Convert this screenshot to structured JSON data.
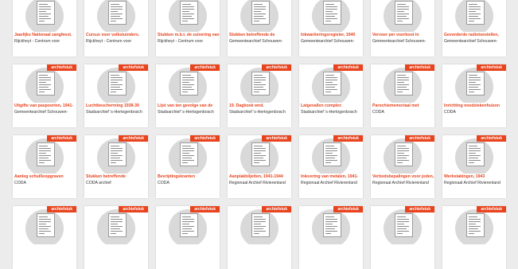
{
  "badge_label": "archiefstuk",
  "colors": {
    "accent": "#e8431d",
    "card": "#ffffff",
    "background": "#ececec",
    "thumb_circle": "#d9d9d9"
  },
  "rows": [
    {
      "show_badge": false,
      "items": [
        {
          "title": "Jaarlijks Nationaal zangfeest.",
          "source": "Rijckheyt - Centrum voor"
        },
        {
          "title": "Cursus voor volkstuinders.",
          "source": "Rijckheyt - Centrum voor"
        },
        {
          "title": "Stukken m.b.t. de zuivering van",
          "source": "Rijckheyt - Centrum voor"
        },
        {
          "title": "Stukken betreffende de",
          "source": "Gemeentearchief Schouwen-"
        },
        {
          "title": "Inkwartieringsregister, 1940",
          "source": "Gemeentearchief Schouwen-"
        },
        {
          "title": "Vervoer per voorboot in",
          "source": "Gemeentearchief Schouwen-"
        },
        {
          "title": "Gevorderde radiotoestellen,",
          "source": "Gemeentearchief Schouwen-"
        }
      ]
    },
    {
      "show_badge": true,
      "items": [
        {
          "title": "Uitgifte van paspoorten, 1941-",
          "source": "Gemeentearchief Schouwen-"
        },
        {
          "title": "Luchtbescherming 1938-39",
          "source": "Stadsarchief 's-Hertogenbosch"
        },
        {
          "title": "Lijst van ten gevolge van de",
          "source": "Stadsarchief 's-Hertogenbosch"
        },
        {
          "title": "19. Dagboek wnd.",
          "source": "Stadsarchief 's-Hertogenbosch"
        },
        {
          "title": "Latgevallen complex",
          "source": "Stadsarchief 's-Hertogenbosch"
        },
        {
          "title": "Parochiememoriaal met",
          "source": "CODA"
        },
        {
          "title": "Inrichting noodziekenhuizen",
          "source": "CODA"
        }
      ]
    },
    {
      "show_badge": true,
      "items": [
        {
          "title": "Aanleg schuilloopgraven",
          "source": "CODA"
        },
        {
          "title": "Stukken betreffende",
          "source": "CODA archief"
        },
        {
          "title": "Bevrijdingskranten",
          "source": "CODA"
        },
        {
          "title": "Aanplakbiljetten, 1941-1944",
          "source": "Regionaal Archief Rivierenland"
        },
        {
          "title": "Inlevering van metalen, 1941-",
          "source": "Regionaal Archief Rivierenland"
        },
        {
          "title": "Verbodsbepalingen voor joden,",
          "source": "Regionaal Archief Rivierenland"
        },
        {
          "title": "Werkstakingen, 1943",
          "source": "Regionaal Archief Rivierenland"
        }
      ]
    },
    {
      "show_badge": true,
      "items": [
        {
          "title": "",
          "source": ""
        },
        {
          "title": "",
          "source": ""
        },
        {
          "title": "",
          "source": ""
        },
        {
          "title": "",
          "source": ""
        },
        {
          "title": "",
          "source": ""
        },
        {
          "title": "",
          "source": ""
        },
        {
          "title": "",
          "source": ""
        }
      ]
    }
  ]
}
